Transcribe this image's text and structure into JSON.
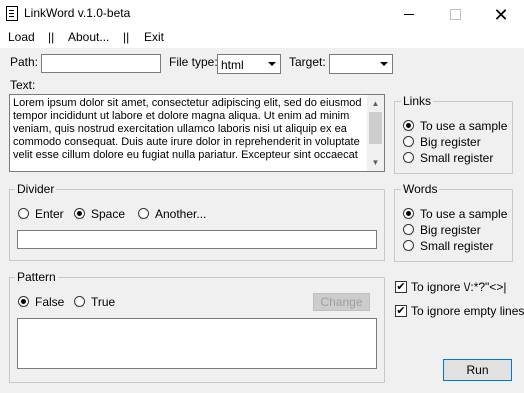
{
  "window": {
    "title": "LinkWord v.1.0-beta",
    "minimize_icon": "minimize-icon",
    "maximize_icon": "maximize-icon",
    "close_icon": "close-icon"
  },
  "menu": {
    "items": [
      "Load",
      "About...",
      "Exit"
    ],
    "separator": "||"
  },
  "path": {
    "label": "Path:",
    "value": ""
  },
  "filetype": {
    "label": "File type:",
    "value": "html"
  },
  "target": {
    "label": "Target:",
    "value": ""
  },
  "text": {
    "label": "Text:",
    "lines": [
      "Lorem ipsum dolor sit amet, consectetur adipiscing elit, sed do eiusmod",
      "tempor incididunt ut labore et dolore magna aliqua. Ut enim ad minim",
      "veniam, quis nostrud exercitation ullamco laboris nisi ut aliquip ex ea",
      "commodo consequat. Duis aute irure dolor in reprehenderit in voluptate",
      "velit esse cillum dolore eu fugiat nulla pariatur. Excepteur sint occaecat"
    ]
  },
  "links": {
    "title": "Links",
    "options": [
      "To use a sample",
      "Big register",
      "Small register"
    ],
    "selected": 0
  },
  "words": {
    "title": "Words",
    "options": [
      "To use a sample",
      "Big register",
      "Small register"
    ],
    "selected": 0
  },
  "divider": {
    "title": "Divider",
    "options": [
      "Enter",
      "Space",
      "Another..."
    ],
    "selected": 1,
    "value": ""
  },
  "pattern": {
    "title": "Pattern",
    "options": [
      "False",
      "True"
    ],
    "selected": 0,
    "change_label": "Change",
    "value": ""
  },
  "checks": [
    {
      "label": "To ignore \\/:*?\"<>|",
      "checked": true
    },
    {
      "label": "To ignore empty lines",
      "checked": true
    }
  ],
  "run_label": "Run"
}
